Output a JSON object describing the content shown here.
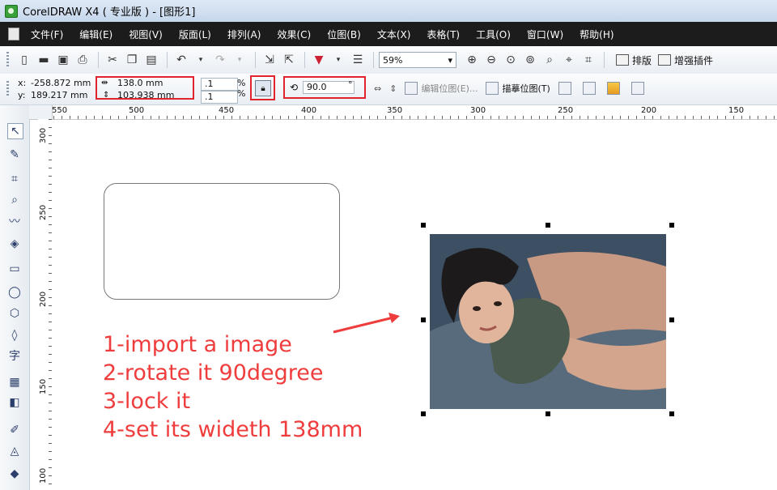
{
  "title": "CorelDRAW X4 ( 专业版 ) - [图形1]",
  "menu": [
    "文件(F)",
    "编辑(E)",
    "视图(V)",
    "版面(L)",
    "排列(A)",
    "效果(C)",
    "位图(B)",
    "文本(X)",
    "表格(T)",
    "工具(O)",
    "窗口(W)",
    "帮助(H)"
  ],
  "toolbar": {
    "zoom": "59%",
    "layout_label": "排版",
    "plugin_label": "增强插件"
  },
  "propbar": {
    "x_label": "x:",
    "x_value": "-258.872 mm",
    "y_label": "y:",
    "y_value": "189.217 mm",
    "width_value": "138.0 mm",
    "height_value": "103.938 mm",
    "scale_w": ".1",
    "scale_h": ".1",
    "percent": "%",
    "rotation_value": "90.0",
    "degree": "°",
    "edit_bitmap": "编辑位图(E)...",
    "trace_bitmap": "描摹位图(T)"
  },
  "ruler": {
    "h_labels": [
      "550",
      "500",
      "450",
      "400",
      "350",
      "300",
      "250",
      "200",
      "150"
    ],
    "v_labels": [
      "300",
      "250",
      "200",
      "150",
      "100"
    ]
  },
  "instructions": [
    "1-import a image",
    "2-rotate it 90degree",
    "3-lock it",
    "4-set its wideth 138mm"
  ],
  "colors": {
    "annotation_red": "#e0232d",
    "text_red": "#ef3d3d",
    "menu_bg": "#1c1c1c"
  }
}
